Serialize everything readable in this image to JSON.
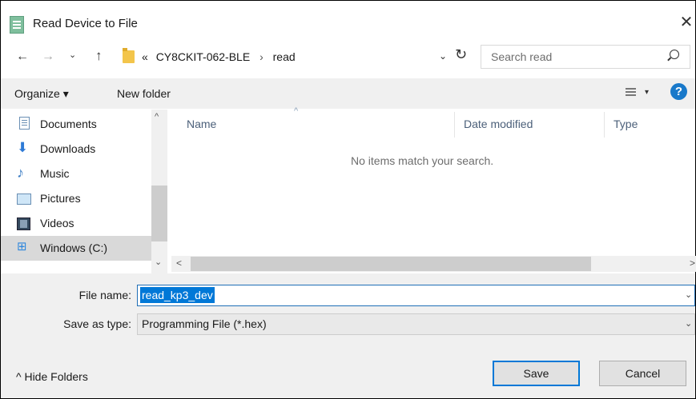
{
  "window": {
    "title": "Read Device to File",
    "close_glyph": "✕"
  },
  "nav": {
    "back_glyph": "←",
    "forward_glyph": "→",
    "recent_glyph": "⌄",
    "up_glyph": "↑",
    "breadcrumb_prefix": "«",
    "breadcrumbs": [
      "CY8CKIT-062-BLE",
      "read"
    ],
    "breadcrumb_sep": "›",
    "address_dropdown_glyph": "⌄",
    "refresh_glyph": "↻"
  },
  "search": {
    "placeholder": "Search read"
  },
  "toolbar": {
    "organize_label": "Organize ▾",
    "new_folder_label": "New folder",
    "view_dropdown_glyph": "▾",
    "help_glyph": "?"
  },
  "nav_pane": {
    "items": [
      {
        "label": "Documents",
        "icon": "documents-icon"
      },
      {
        "label": "Downloads",
        "icon": "downloads-icon"
      },
      {
        "label": "Music",
        "icon": "music-icon"
      },
      {
        "label": "Pictures",
        "icon": "pictures-icon"
      },
      {
        "label": "Videos",
        "icon": "videos-icon"
      },
      {
        "label": "Windows (C:)",
        "icon": "drive-icon",
        "selected": true
      }
    ],
    "scroll_up_glyph": "^",
    "scroll_down_glyph": "⌄"
  },
  "content": {
    "columns": [
      "Name",
      "Date modified",
      "Type"
    ],
    "sort_glyph": "^",
    "empty_message": "No items match your search.",
    "scroll_left_glyph": "<",
    "scroll_right_glyph": ">"
  },
  "form": {
    "file_name_label": "File name:",
    "file_name_value": "read_kp3_dev",
    "save_type_label": "Save as type:",
    "save_type_value": "Programming File (*.hex)",
    "dropdown_glyph": "⌄"
  },
  "footer": {
    "hide_folders_label": "^ Hide Folders",
    "save_label": "Save",
    "cancel_label": "Cancel"
  },
  "colors": {
    "accent": "#0078d7",
    "help": "#1979ca",
    "panel": "#f0f0f0",
    "selection": "#d9d9d9"
  }
}
